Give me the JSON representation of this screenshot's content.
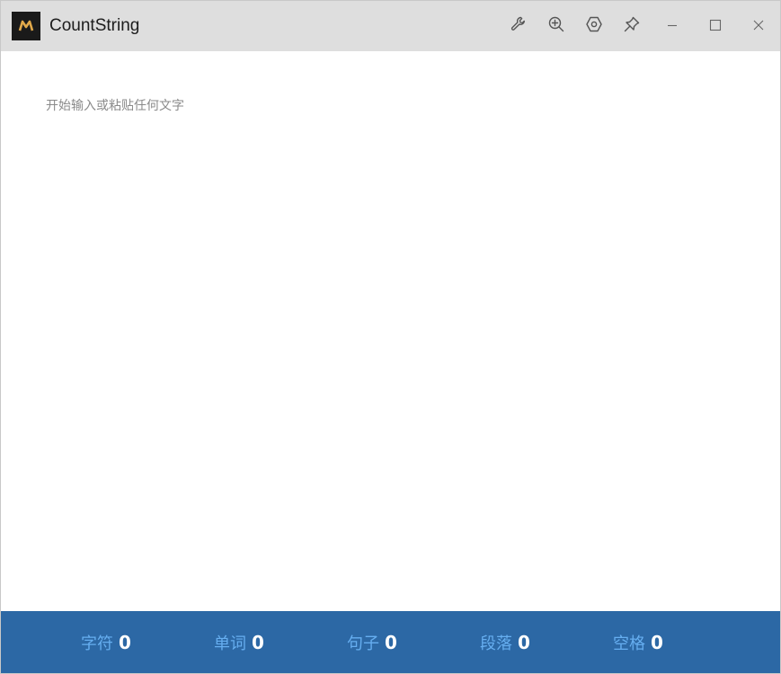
{
  "window": {
    "title": "CountString"
  },
  "toolbar": {
    "icons": [
      "wrench-icon",
      "zoom-in-icon",
      "settings-icon",
      "pin-icon"
    ],
    "window_controls": [
      "minimize-icon",
      "maximize-icon",
      "close-icon"
    ]
  },
  "editor": {
    "placeholder": "开始输入或粘贴任何文字",
    "value": ""
  },
  "stats": [
    {
      "label": "字符",
      "value": "0"
    },
    {
      "label": "单词",
      "value": "0"
    },
    {
      "label": "句子",
      "value": "0"
    },
    {
      "label": "段落",
      "value": "0"
    },
    {
      "label": "空格",
      "value": "0"
    }
  ],
  "colors": {
    "titlebar_bg": "#dedede",
    "statusbar_bg": "#2c68a5",
    "stat_label": "#66aef0",
    "stat_value": "#ffffff"
  }
}
